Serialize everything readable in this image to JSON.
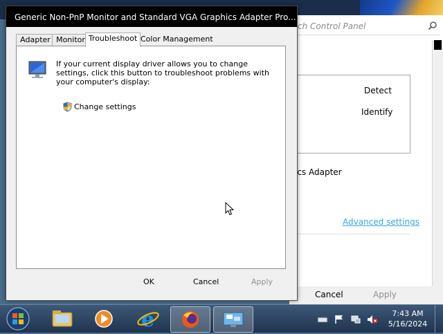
{
  "background_window": {
    "search_placeholder": "ch Control Panel",
    "detect_label": "Detect",
    "identify_label": "Identify",
    "adapter_text": "ics Adapter",
    "advanced_link": "Advanced settings",
    "cancel_label": "Cancel",
    "apply_label": "Apply"
  },
  "dialog": {
    "title": "Generic Non-PnP Monitor and Standard VGA Graphics Adapter Pro...",
    "tabs": [
      {
        "label": "Adapter",
        "active": false
      },
      {
        "label": "Monitor",
        "active": false
      },
      {
        "label": "Troubleshoot",
        "active": true
      },
      {
        "label": "Color Management",
        "active": false
      }
    ],
    "description": "If your current display driver allows you to change settings, click this button to troubleshoot problems with your computer's display:",
    "change_settings_label": "Change settings",
    "ok_label": "OK",
    "cancel_label": "Cancel",
    "apply_label": "Apply"
  },
  "taskbar": {
    "items": [
      "start-orb",
      "file-explorer",
      "media-player",
      "internet-explorer",
      "firefox",
      "display-settings"
    ],
    "clock_time": "7:43 AM",
    "clock_date": "5/16/2024"
  },
  "colors": {
    "link": "#35a7e6",
    "titlebar": "#000000",
    "dialog_bg": "#f0f0f0",
    "disabled_text": "#8f8f8f"
  }
}
